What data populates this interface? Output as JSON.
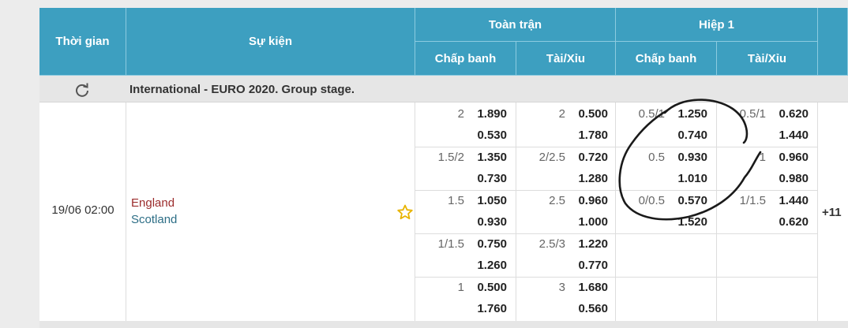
{
  "header": {
    "time_label": "Thời gian",
    "event_label": "Sự kiện",
    "fulltime_label": "Toàn trận",
    "half1_label": "Hiệp 1",
    "handicap_label": "Chấp banh",
    "overunder_label": "Tài/Xỉu"
  },
  "league": {
    "name": "International - EURO 2020. Group stage."
  },
  "match": {
    "time": "19/06 02:00",
    "home": "England",
    "away": "Scotland",
    "more": "+11"
  },
  "fulltime": {
    "handicap": [
      {
        "line": "2",
        "top": "1.890",
        "bottom": "0.530"
      },
      {
        "line": "1.5/2",
        "top": "1.350",
        "bottom": "0.730"
      },
      {
        "line": "1.5",
        "top": "1.050",
        "bottom": "0.930"
      },
      {
        "line": "1/1.5",
        "top": "0.750",
        "bottom": "1.260"
      },
      {
        "line": "1",
        "top": "0.500",
        "bottom": "1.760"
      }
    ],
    "overunder": [
      {
        "line": "2",
        "top": "0.500",
        "bottom": "1.780"
      },
      {
        "line": "2/2.5",
        "top": "0.720",
        "bottom": "1.280"
      },
      {
        "line": "2.5",
        "top": "0.960",
        "bottom": "1.000"
      },
      {
        "line": "2.5/3",
        "top": "1.220",
        "bottom": "0.770"
      },
      {
        "line": "3",
        "top": "1.680",
        "bottom": "0.560"
      }
    ]
  },
  "half1": {
    "handicap": [
      {
        "line": "0.5/1",
        "top": "1.250",
        "bottom": "0.740"
      },
      {
        "line": "0.5",
        "top": "0.930",
        "bottom": "1.010"
      },
      {
        "line": "0/0.5",
        "top": "0.570",
        "bottom": "1.520"
      }
    ],
    "overunder": [
      {
        "line": "0.5/1",
        "top": "0.620",
        "bottom": "1.440"
      },
      {
        "line": "1",
        "top": "0.960",
        "bottom": "0.980"
      },
      {
        "line": "1/1.5",
        "top": "1.440",
        "bottom": "0.620"
      }
    ]
  },
  "colors": {
    "header_bg": "#3d9fc0",
    "home_team": "#9b2b2b",
    "away_team": "#2d6e86",
    "star": "#e8b400"
  },
  "icons": {
    "refresh": "refresh-icon",
    "favorite": "star-icon"
  }
}
